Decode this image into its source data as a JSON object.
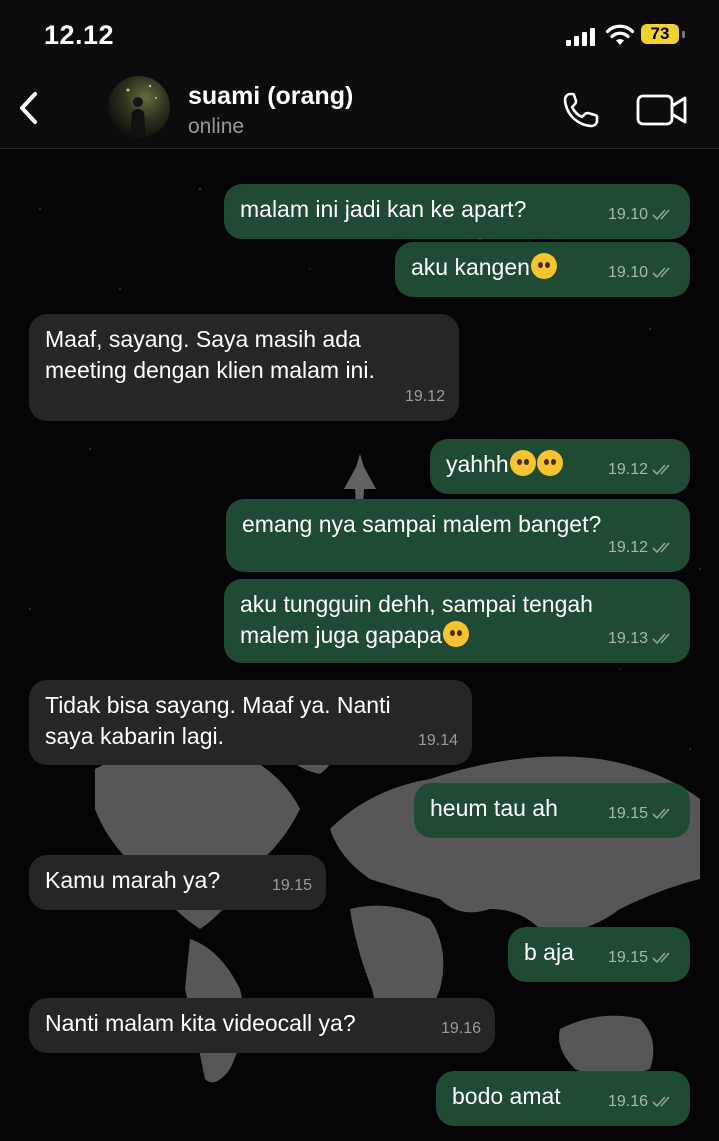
{
  "statusbar": {
    "time": "12.12",
    "battery": "73"
  },
  "header": {
    "name": "suami (orang)",
    "status": "online"
  },
  "messages": [
    {
      "dir": "out",
      "text": "malam ini jadi kan ke apart?",
      "time": "19.10",
      "emoji": []
    },
    {
      "dir": "out",
      "text": "aku kangen",
      "time": "19.10",
      "emoji": [
        "pleading-face"
      ]
    },
    {
      "dir": "in",
      "text": "Maaf, sayang. Saya masih ada\nmeeting dengan klien malam ini.",
      "time": "19.12",
      "emoji": []
    },
    {
      "dir": "out",
      "text": "yahhh",
      "time": "19.12",
      "emoji": [
        "pensive-face",
        "persevering-face"
      ]
    },
    {
      "dir": "out",
      "text": "emang nya sampai malem banget?",
      "time": "19.12",
      "emoji": []
    },
    {
      "dir": "out",
      "text": "aku tungguin dehh, sampai tengah\nmalem juga gapapa",
      "time": "19.13",
      "emoji": [
        "pleading-face"
      ]
    },
    {
      "dir": "in",
      "text": "Tidak bisa sayang. Maaf ya. Nanti\nsaya kabarin lagi.",
      "time": "19.14",
      "emoji": []
    },
    {
      "dir": "out",
      "text": "heum tau ah",
      "time": "19.15",
      "emoji": []
    },
    {
      "dir": "in",
      "text": "Kamu marah ya?",
      "time": "19.15",
      "emoji": []
    },
    {
      "dir": "out",
      "text": "b aja",
      "time": "19.15",
      "emoji": []
    },
    {
      "dir": "in",
      "text": "Nanti malam kita videocall ya?",
      "time": "19.16",
      "emoji": []
    },
    {
      "dir": "out",
      "text": "bodo amat",
      "time": "19.16",
      "emoji": []
    }
  ],
  "icons": {
    "back": "chevron-left-icon",
    "call": "phone-icon",
    "video": "video-camera-icon"
  },
  "colors": {
    "outgoing_bubble": "#1f4a33",
    "incoming_bubble": "#262626",
    "battery": "#f2d233"
  }
}
